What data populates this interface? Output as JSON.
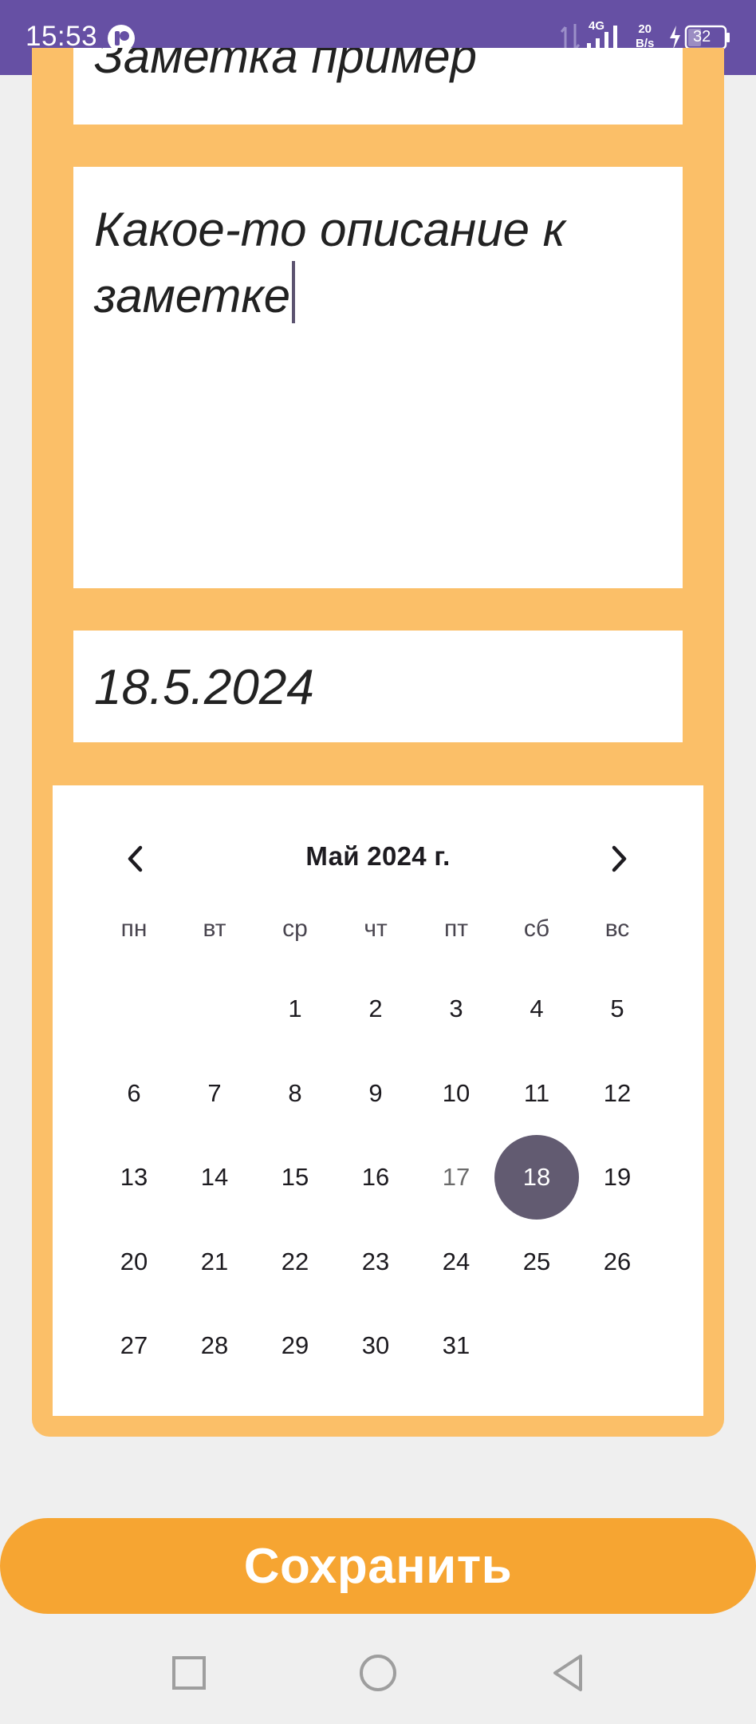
{
  "status_bar": {
    "time": "15:53",
    "network_type": "4G",
    "speed_value": "20",
    "speed_unit": "B/s",
    "battery": "32",
    "background": "#6650a4"
  },
  "note": {
    "title": "Заметка пример",
    "description": "Какое-то описание к заметке",
    "date": "18.5.2024"
  },
  "calendar": {
    "month_title": "Май 2024 г.",
    "weekdays": [
      "пн",
      "вт",
      "ср",
      "чт",
      "пт",
      "сб",
      "вс"
    ],
    "first_weekday_index": 2,
    "days_in_month": 31,
    "today": 17,
    "selected": 18,
    "selected_color": "#625b71"
  },
  "actions": {
    "save_label": "Сохранить"
  },
  "colors": {
    "card": "#fbbf68",
    "save_button": "#f6a532"
  },
  "nav": {
    "icons": [
      "recents-square-icon",
      "home-circle-icon",
      "back-triangle-icon"
    ]
  }
}
